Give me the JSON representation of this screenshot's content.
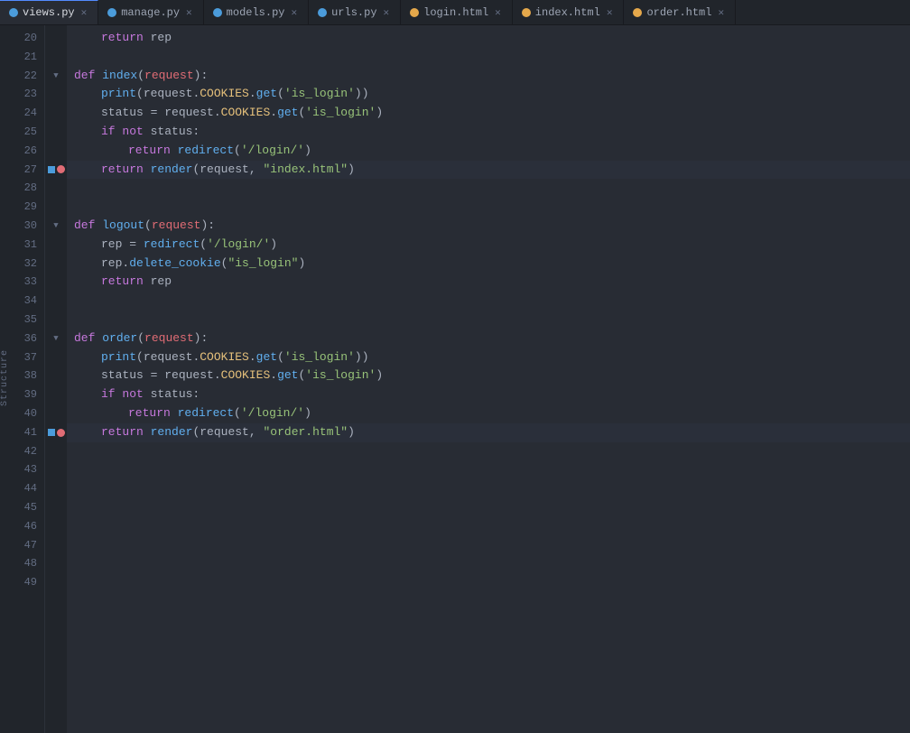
{
  "tabs": [
    {
      "label": "views.py",
      "type": "py",
      "active": true,
      "closable": true
    },
    {
      "label": "manage.py",
      "type": "py",
      "active": false,
      "closable": true
    },
    {
      "label": "models.py",
      "type": "py",
      "active": false,
      "closable": true
    },
    {
      "label": "urls.py",
      "type": "py",
      "active": false,
      "closable": true
    },
    {
      "label": "login.html",
      "type": "html",
      "active": false,
      "closable": true
    },
    {
      "label": "index.html",
      "type": "html",
      "active": false,
      "closable": true
    },
    {
      "label": "order.html",
      "type": "html",
      "active": false,
      "closable": true
    }
  ],
  "structure_label": "Structure",
  "lines": [
    {
      "num": 20,
      "gutter": "",
      "code": "    return rep"
    },
    {
      "num": 21,
      "gutter": "",
      "code": ""
    },
    {
      "num": 22,
      "gutter": "fold",
      "code": "def index(request):"
    },
    {
      "num": 23,
      "gutter": "",
      "code": "    print(request.COOKIES.get('is_login'))"
    },
    {
      "num": 24,
      "gutter": "",
      "code": "    status = request.COOKIES.get('is_login')"
    },
    {
      "num": 25,
      "gutter": "",
      "code": "    if not status:"
    },
    {
      "num": 26,
      "gutter": "",
      "code": "        return redirect('/login/')"
    },
    {
      "num": 27,
      "gutter": "bookmark+bp",
      "code": "    return render(request, \"index.html\")"
    },
    {
      "num": 28,
      "gutter": "",
      "code": ""
    },
    {
      "num": 29,
      "gutter": "",
      "code": ""
    },
    {
      "num": 30,
      "gutter": "fold",
      "code": "def logout(request):"
    },
    {
      "num": 31,
      "gutter": "",
      "code": "    rep = redirect('/login/')"
    },
    {
      "num": 32,
      "gutter": "",
      "code": "    rep.delete_cookie(\"is_login\")"
    },
    {
      "num": 33,
      "gutter": "",
      "code": "    return rep"
    },
    {
      "num": 34,
      "gutter": "",
      "code": ""
    },
    {
      "num": 35,
      "gutter": "",
      "code": ""
    },
    {
      "num": 36,
      "gutter": "fold",
      "code": "def order(request):"
    },
    {
      "num": 37,
      "gutter": "",
      "code": "    print(request.COOKIES.get('is_login'))"
    },
    {
      "num": 38,
      "gutter": "",
      "code": "    status = request.COOKIES.get('is_login')"
    },
    {
      "num": 39,
      "gutter": "",
      "code": "    if not status:"
    },
    {
      "num": 40,
      "gutter": "",
      "code": "        return redirect('/login/')"
    },
    {
      "num": 41,
      "gutter": "bookmark+bp",
      "code": "    return render(request, \"order.html\")"
    },
    {
      "num": 42,
      "gutter": "",
      "code": ""
    },
    {
      "num": 43,
      "gutter": "",
      "code": ""
    },
    {
      "num": 44,
      "gutter": "",
      "code": ""
    },
    {
      "num": 45,
      "gutter": "",
      "code": ""
    },
    {
      "num": 46,
      "gutter": "",
      "code": ""
    },
    {
      "num": 47,
      "gutter": "",
      "code": ""
    },
    {
      "num": 48,
      "gutter": "",
      "code": ""
    },
    {
      "num": 49,
      "gutter": "",
      "code": ""
    }
  ]
}
